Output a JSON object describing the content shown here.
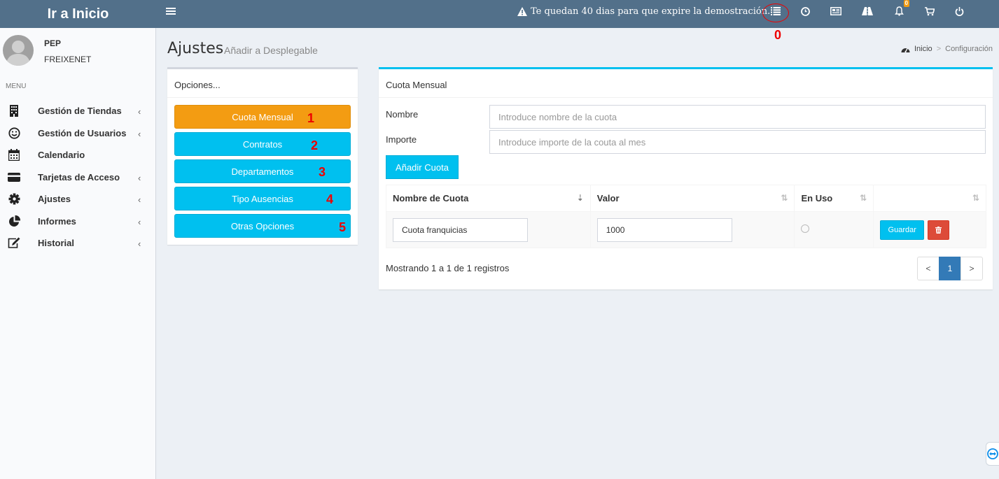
{
  "topbar": {
    "brand": "Ir a Inicio",
    "warning": "Te quedan 40 dias para que expire la demostración.",
    "notification_count": "0",
    "annotation_zero": "0"
  },
  "sidebar": {
    "user_name": "PEP",
    "user_org": "FREIXENET",
    "menu_header": "MENU",
    "items": [
      {
        "label": "Gestión de Tiendas",
        "icon": "building-icon"
      },
      {
        "label": "Gestión de Usuarios",
        "icon": "smile-icon"
      },
      {
        "label": "Calendario",
        "icon": "calendar-icon"
      },
      {
        "label": "Tarjetas de Acceso",
        "icon": "credit-card-icon"
      },
      {
        "label": "Ajustes",
        "icon": "gear-icon"
      },
      {
        "label": "Informes",
        "icon": "pie-chart-icon"
      },
      {
        "label": "Historial",
        "icon": "edit-icon"
      }
    ]
  },
  "page": {
    "title": "Ajustes",
    "subtitle": "Añadir a Desplegable",
    "breadcrumb": [
      "Inicio",
      "Configuración"
    ]
  },
  "options_box": {
    "title": "Opciones...",
    "buttons": [
      "Cuota Mensual",
      "Contratos",
      "Departamentos",
      "Tipo Ausencias",
      "Otras Opciones"
    ],
    "annotations": [
      "1",
      "2",
      "3",
      "4",
      "5"
    ]
  },
  "main_box": {
    "title": "Cuota Mensual",
    "nombre_label": "Nombre",
    "nombre_placeholder": "Introduce nombre de la cuota",
    "importe_label": "Importe",
    "importe_placeholder": "Introduce importe de la couta al mes",
    "add_button": "Añadir Cuota",
    "table": {
      "headers": [
        "Nombre de Cuota",
        "Valor",
        "En Uso",
        ""
      ],
      "rows": [
        {
          "nombre": "Cuota franquicias",
          "valor": "1000",
          "en_uso": false
        }
      ],
      "save_label": "Guardar"
    },
    "info": "Mostrando 1 a 1 de 1 registros",
    "pagination": {
      "prev": "<",
      "current": "1",
      "next": ">"
    }
  },
  "colors": {
    "topbar": "#52708a",
    "accent_cyan": "#00c0ef",
    "accent_orange": "#f39c12",
    "danger": "#dd4b39",
    "page_active": "#337ab7",
    "annotation_red": "#e00000"
  }
}
